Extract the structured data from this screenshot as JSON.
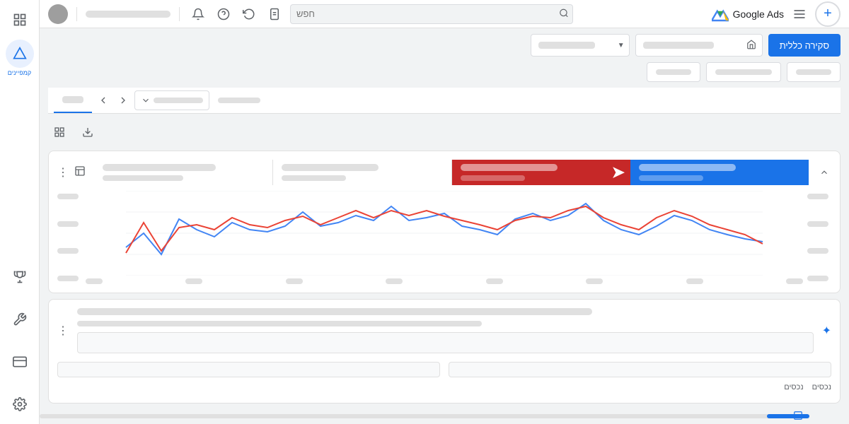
{
  "app": {
    "title": "Google Ads",
    "logo_alt": "Google Ads logo"
  },
  "topbar": {
    "search_placeholder": "חפש",
    "notifications_icon": "🔔",
    "help_icon": "❓",
    "undo_icon": "↩",
    "history_icon": "📋",
    "menu_icon": "☰",
    "plus_label": "+"
  },
  "sidebar": {
    "campaigns_icon": "📢",
    "campaigns_label": "קמפיינים",
    "trophy_icon": "🏆",
    "tools_icon": "🔧",
    "billing_icon": "💳",
    "settings_icon": "⚙️"
  },
  "filter_bar": {
    "dropdown1_placeholder": "──────────",
    "dropdown2_placeholder": "──────────",
    "date_btn_label": "סקירה כללית"
  },
  "secondary_bar": {
    "btn1": "──────",
    "btn2": "──────────",
    "btn3": "──────"
  },
  "tabs": {
    "active_label": "──",
    "dropdown_label": "──────────",
    "extra_label": "──────"
  },
  "overview": {
    "title": "סקירה כללית",
    "new_campaign_label": "+ ──────────────"
  },
  "action_icons": {
    "download": "⬇",
    "expand": "⊞"
  },
  "metrics": [
    {
      "id": "m1",
      "type": "normal"
    },
    {
      "id": "m2",
      "type": "normal"
    },
    {
      "id": "m3",
      "type": "red",
      "arrow": "➤"
    },
    {
      "id": "m4",
      "type": "blue"
    }
  ],
  "chart": {
    "blue_line": [
      0,
      20,
      5,
      28,
      22,
      18,
      25,
      20,
      18,
      22,
      30,
      20,
      22,
      28,
      25,
      32,
      25,
      28,
      30,
      22,
      20,
      18,
      28,
      30,
      25,
      28,
      35,
      25,
      20,
      18,
      22,
      28,
      25,
      20,
      18,
      16
    ],
    "red_line": [
      5,
      25,
      8,
      22,
      25,
      20,
      28,
      22,
      20,
      25,
      28,
      22,
      25,
      30,
      28,
      30,
      28,
      30,
      28,
      25,
      22,
      20,
      25,
      28,
      28,
      30,
      32,
      28,
      22,
      20,
      25,
      30,
      28,
      22,
      20,
      18
    ],
    "y_labels": [
      "──",
      "──",
      "──",
      "──"
    ],
    "x_labels": [
      "──",
      "──",
      "──",
      "──",
      "──",
      "──",
      "──",
      "──"
    ]
  },
  "bottom_panel": {
    "menu_icon": "⋮",
    "sparkle_label": "✦",
    "loading_bar1_width": "70%",
    "loading_bar2_width": "55%",
    "campaigns_label1": "נכסים",
    "campaigns_label2": "נכסים"
  },
  "scrollbar": {
    "visible": true
  }
}
